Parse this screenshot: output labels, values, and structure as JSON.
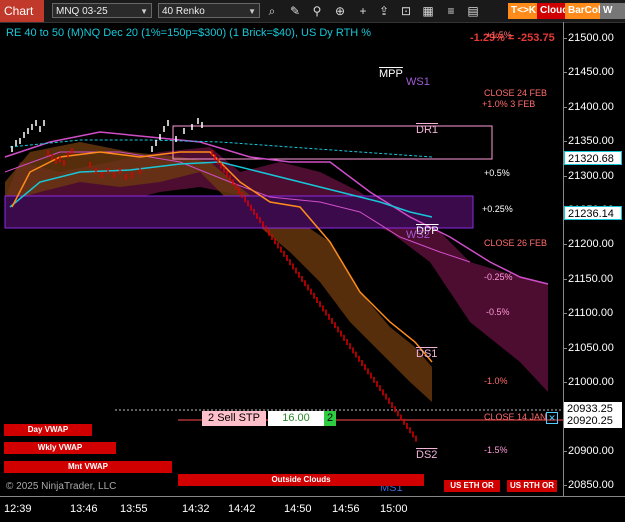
{
  "toolbar": {
    "title": "Chart",
    "instrument": "MNQ 03-25",
    "bar_type": "40 Renko",
    "icons": [
      "search-icon",
      "chart-type-icon",
      "indicator-icon",
      "pencil-icon",
      "zoom-icon",
      "crosshair-icon",
      "add-icon",
      "export-icon",
      "lock-icon",
      "layout-icon",
      "settings-icon",
      "properties-icon"
    ],
    "buttons": {
      "toggle": "T<>K",
      "cloud": "Cloud",
      "barcol": "BarCol",
      "w": "W Vwa"
    }
  },
  "chart": {
    "title": "RE 40 to 50 (M)NQ Dec 20 (1%=150p=$300) (1 Brick=$40), US Dy RTH %",
    "top_pct": "-1.29% = -253.75",
    "y_ticks": [
      "21500.00",
      "21450.00",
      "21400.00",
      "21350.00",
      "21300.00",
      "21250.00",
      "21200.00",
      "21150.00",
      "21100.00",
      "21050.00",
      "21000.00",
      "20950.00",
      "20900.00",
      "20850.00"
    ],
    "x_ticks": [
      "12:39",
      "13:46",
      "13:55",
      "14:32",
      "14:42",
      "14:50",
      "14:56",
      "15:00"
    ],
    "price_flags": {
      "upper": "21320.68",
      "mid": "21236.14",
      "last": "20933.25",
      "last2": "20920.25"
    },
    "levels": {
      "mpp": "MPP",
      "ws1": "WS1",
      "dr1": "DR1",
      "dpp": "DPP",
      "ws2": "WS2",
      "ds1": "DS1",
      "ds2": "DS2",
      "ms1": "MS1",
      "close_24feb": "CLOSE 24 FEB",
      "close_3feb": "+1.0% 3 FEB",
      "close_26feb": "CLOSE 26 FEB",
      "close_14jan": "CLOSE 14 JAN",
      "p05": "+0.5%",
      "p025": "+0.25%",
      "m025": "-0.25%",
      "m05": "-0.5%",
      "m10": "-1.0%",
      "m15": "-1.5%",
      "p15top": "+1.5%"
    },
    "order": {
      "label": "2 Sell STP",
      "price": "16.00",
      "qty": "2"
    },
    "vwap_buttons": {
      "day": "Day VWAP",
      "weekly": "Wkly VWAP",
      "monthly": "Mnt VWAP",
      "outside": "Outside Clouds",
      "eth": "US ETH OR",
      "rth": "US RTH OR"
    },
    "watermark": "© 2025 NinjaTrader, LLC",
    "colors": {
      "up": "#ffffff",
      "down": "#e00000",
      "cyan": "#17c7d9",
      "orange": "#ff8c1a",
      "magenta": "#d04dc8",
      "purple_box": "#8a2be2"
    }
  }
}
